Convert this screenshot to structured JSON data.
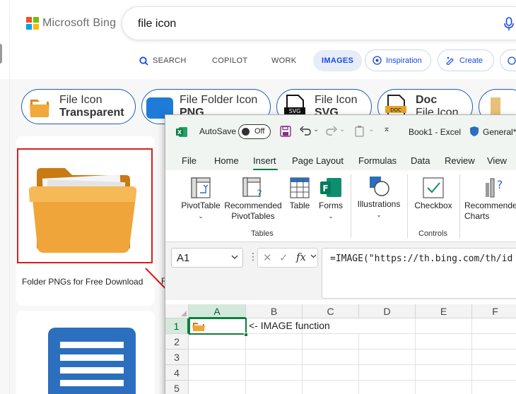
{
  "bing": {
    "logo_text": "Microsoft Bing",
    "search_query": "file icon",
    "nav": {
      "search": "SEARCH",
      "copilot": "COPILOT",
      "work": "WORK",
      "images": "IMAGES",
      "inspiration": "Inspiration",
      "create": "Create"
    },
    "chips": [
      {
        "line1": "File Icon",
        "line2": "Transparent"
      },
      {
        "line1": "File Folder Icon",
        "line2": "PNG"
      },
      {
        "line1": "File Icon",
        "line2": "SVG"
      },
      {
        "line1": "Doc",
        "line2": "File Icon"
      }
    ],
    "results": [
      {
        "caption": "Folder PNGs for Free Download"
      },
      {
        "caption_fragment": "F"
      }
    ],
    "colors": {
      "accent": "#174ae4",
      "highlight_border": "#d81e1e"
    }
  },
  "excel": {
    "autosave_label": "AutoSave",
    "autosave_state": "Off",
    "workbook": "Book1",
    "app": "Excel",
    "sensitivity": "General*",
    "menu": [
      "File",
      "Home",
      "Insert",
      "Page Layout",
      "Formulas",
      "Data",
      "Review",
      "View"
    ],
    "active_tab": "Insert",
    "ribbon": {
      "pivot_table": "PivotTable",
      "recommended_pivot": "Recommended PivotTables",
      "table": "Table",
      "forms": "Forms",
      "illustrations": "Illustrations",
      "checkbox": "Checkbox",
      "recommended_charts": "Recommended Charts",
      "group_tables": "Tables",
      "group_controls": "Controls"
    },
    "name_box": "A1",
    "formula": "=IMAGE(\"https://th.bing.com/th/id",
    "columns": [
      "A",
      "B",
      "C",
      "D",
      "E",
      "F"
    ],
    "rows": [
      "1",
      "2",
      "3",
      "4",
      "5"
    ],
    "cell_b1": "<- IMAGE function",
    "colors": {
      "excel_green": "#107c41"
    }
  }
}
